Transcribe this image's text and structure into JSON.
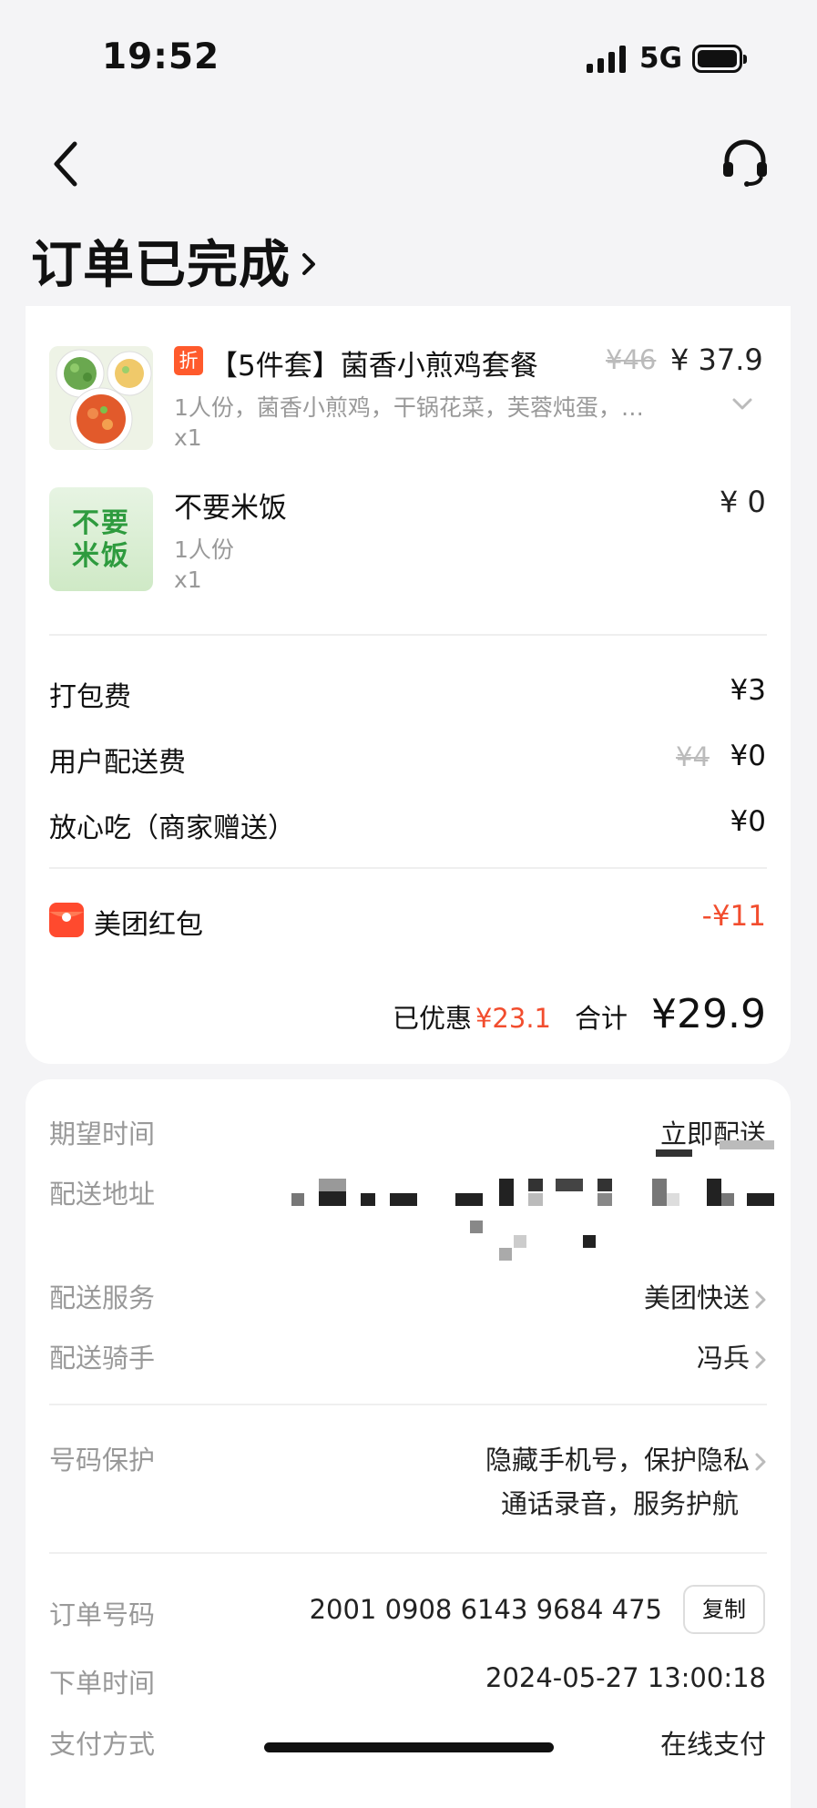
{
  "status_bar": {
    "time": "19:52",
    "network": "5G"
  },
  "nav": {
    "back_icon": "chevron-left-icon",
    "service_icon": "headset-icon"
  },
  "order_status": {
    "title": "订单已完成"
  },
  "items": [
    {
      "badge": "折",
      "name": "【5件套】菌香小煎鸡套餐",
      "original_price": "¥46",
      "price": "¥ 37.9",
      "desc": "1人份，菌香小煎鸡，干锅花菜，芙蓉炖蛋，…",
      "qty": "x1",
      "image_icon": "meal-set-image"
    },
    {
      "name": "不要米饭",
      "price": "¥ 0",
      "desc": "1人份",
      "qty": "x1",
      "image_text": "不要米饭"
    }
  ],
  "fees": {
    "packing": {
      "label": "打包费",
      "value": "¥3"
    },
    "delivery": {
      "label": "用户配送费",
      "original": "¥4",
      "value": "¥0"
    },
    "safe_eat": {
      "label": "放心吃（商家赠送）",
      "value": "¥0"
    },
    "red_packet": {
      "label": "美团红包",
      "value": "-¥11",
      "icon": "red-packet-icon"
    }
  },
  "summary": {
    "discount_label": "已优惠",
    "discount_value": "¥23.1",
    "total_label": "合计",
    "total_value": "¥29.9"
  },
  "delivery_info": {
    "expected_time": {
      "label": "期望时间",
      "value": "立即配送"
    },
    "address": {
      "label": "配送地址"
    },
    "service": {
      "label": "配送服务",
      "value": "美团快送"
    },
    "rider": {
      "label": "配送骑手",
      "value": "冯兵"
    },
    "privacy": {
      "label": "号码保护",
      "line1": "隐藏手机号，保护隐私",
      "line2": "通话录音，服务护航"
    },
    "order_no": {
      "label": "订单号码",
      "value": "2001 0908 6143 9684 475",
      "copy_label": "复制"
    },
    "order_time": {
      "label": "下单时间",
      "value": "2024-05-27 13:00:18"
    },
    "payment": {
      "label": "支付方式",
      "value": "在线支付"
    }
  },
  "colors": {
    "accent_red": "#f24d2e",
    "badge_orange": "#ff5a2c",
    "muted": "#999999"
  }
}
